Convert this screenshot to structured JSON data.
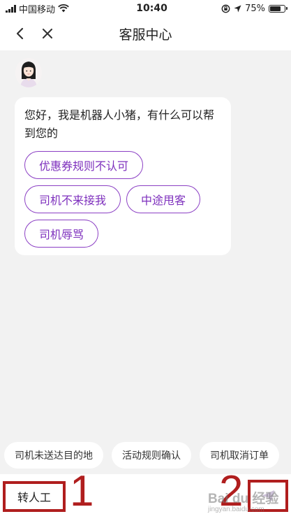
{
  "status_bar": {
    "carrier": "中国移动",
    "time": "10:40",
    "battery": "75%",
    "battery_level": 0.75,
    "icons": [
      "signal-icon",
      "wifi-icon",
      "orientation-lock-icon",
      "location-icon",
      "battery-icon"
    ]
  },
  "nav": {
    "title": "客服中心",
    "back_icon": "chevron-left-icon",
    "close_icon": "close-icon"
  },
  "chat": {
    "bot_avatar": "female-agent-avatar",
    "greeting": "您好，我是机器人小猪，有什么可以帮到您的",
    "suggestions": [
      "优惠券规则不认可",
      "司机不来接我",
      "中途甩客",
      "司机辱骂"
    ]
  },
  "quick_replies": [
    "司机未送达目的地",
    "活动规则确认",
    "司机取消订单"
  ],
  "input_bar": {
    "human_button": "转人工",
    "message_placeholder": "",
    "send_icon": "send-icon"
  },
  "annotations": {
    "marker_1": "1",
    "marker_2": "2",
    "watermark_main": "Bai du 经验",
    "watermark_sub": "jingyan.baidu.com"
  },
  "colors": {
    "accent": "#8b3fc4",
    "annotation_red": "#b01e1e",
    "background": "#f2f2f2"
  }
}
